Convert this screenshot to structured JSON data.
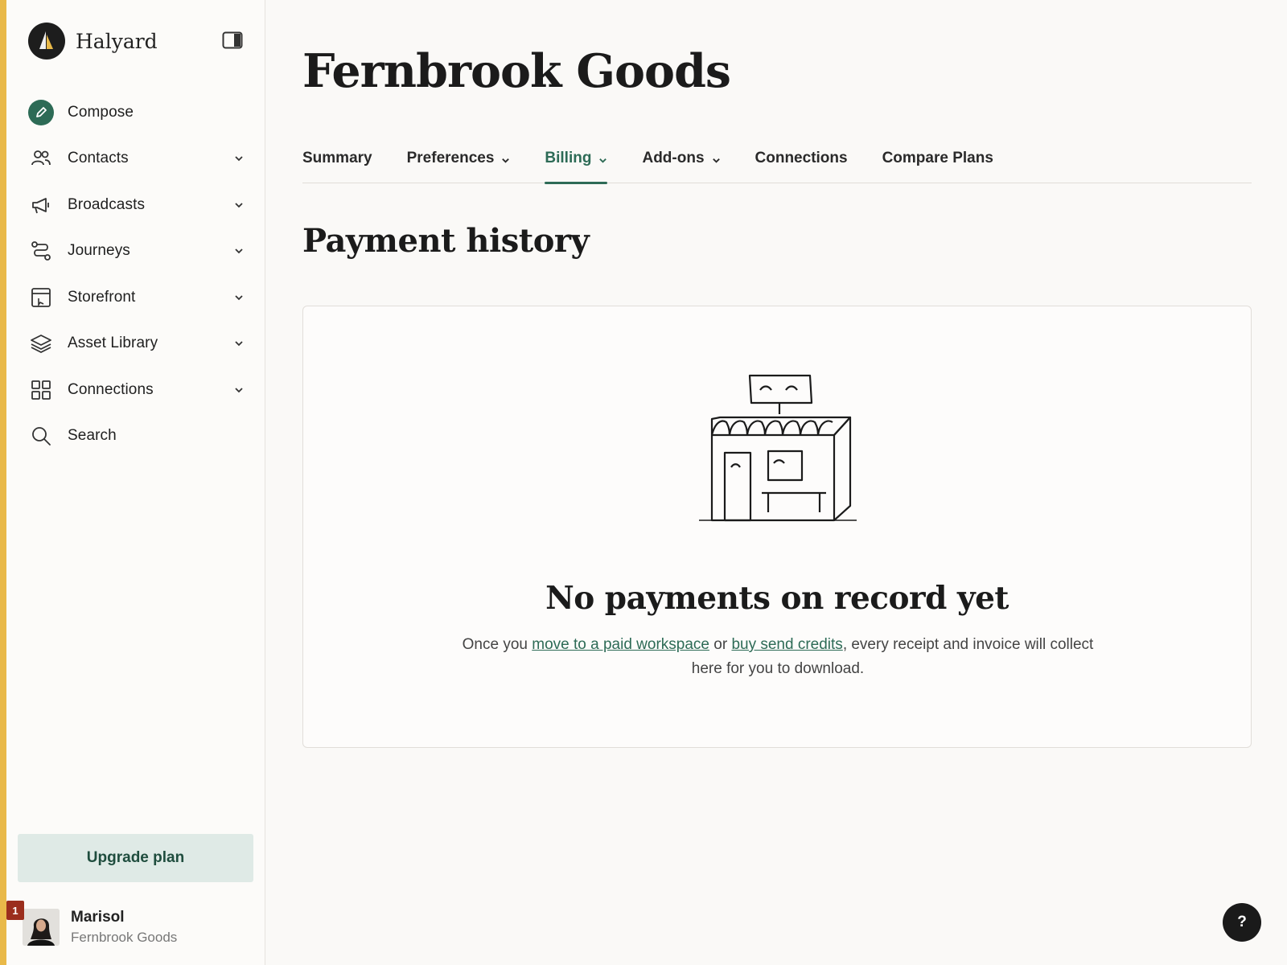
{
  "brand": {
    "name": "Halyard",
    "logo_icon": "sail-logo-icon"
  },
  "sidebar": {
    "items": [
      {
        "label": "Compose",
        "icon": "pencil-icon",
        "has_chevron": false
      },
      {
        "label": "Contacts",
        "icon": "users-icon",
        "has_chevron": true
      },
      {
        "label": "Broadcasts",
        "icon": "megaphone-icon",
        "has_chevron": true
      },
      {
        "label": "Journeys",
        "icon": "route-icon",
        "has_chevron": true
      },
      {
        "label": "Storefront",
        "icon": "storefront-icon",
        "has_chevron": true
      },
      {
        "label": "Asset Library",
        "icon": "layers-icon",
        "has_chevron": true
      },
      {
        "label": "Connections",
        "icon": "grid-icon",
        "has_chevron": true
      },
      {
        "label": "Search",
        "icon": "search-icon",
        "has_chevron": false
      }
    ],
    "upgrade_label": "Upgrade plan",
    "user": {
      "name": "Marisol",
      "org": "Fernbrook Goods",
      "notification_count": "1"
    }
  },
  "main": {
    "title": "Fernbrook Goods",
    "tabs": [
      {
        "label": "Summary",
        "dropdown": false,
        "active": false
      },
      {
        "label": "Preferences",
        "dropdown": true,
        "active": false
      },
      {
        "label": "Billing",
        "dropdown": true,
        "active": true
      },
      {
        "label": "Add-ons",
        "dropdown": true,
        "active": false
      },
      {
        "label": "Connections",
        "dropdown": false,
        "active": false
      },
      {
        "label": "Compare Plans",
        "dropdown": false,
        "active": false
      }
    ],
    "section_title": "Payment history",
    "empty_state": {
      "title": "No payments on record yet",
      "text_before": "Once you ",
      "link1": "move to a paid workspace",
      "text_mid": " or ",
      "link2": "buy send credits",
      "text_after": ", every receipt and invoice will collect here for you to download."
    }
  },
  "help_label": "?",
  "colors": {
    "accent_bar": "#e9b949",
    "brand_green": "#2d6b56",
    "upgrade_bg": "#dfeae6",
    "badge": "#9b2e1d"
  }
}
